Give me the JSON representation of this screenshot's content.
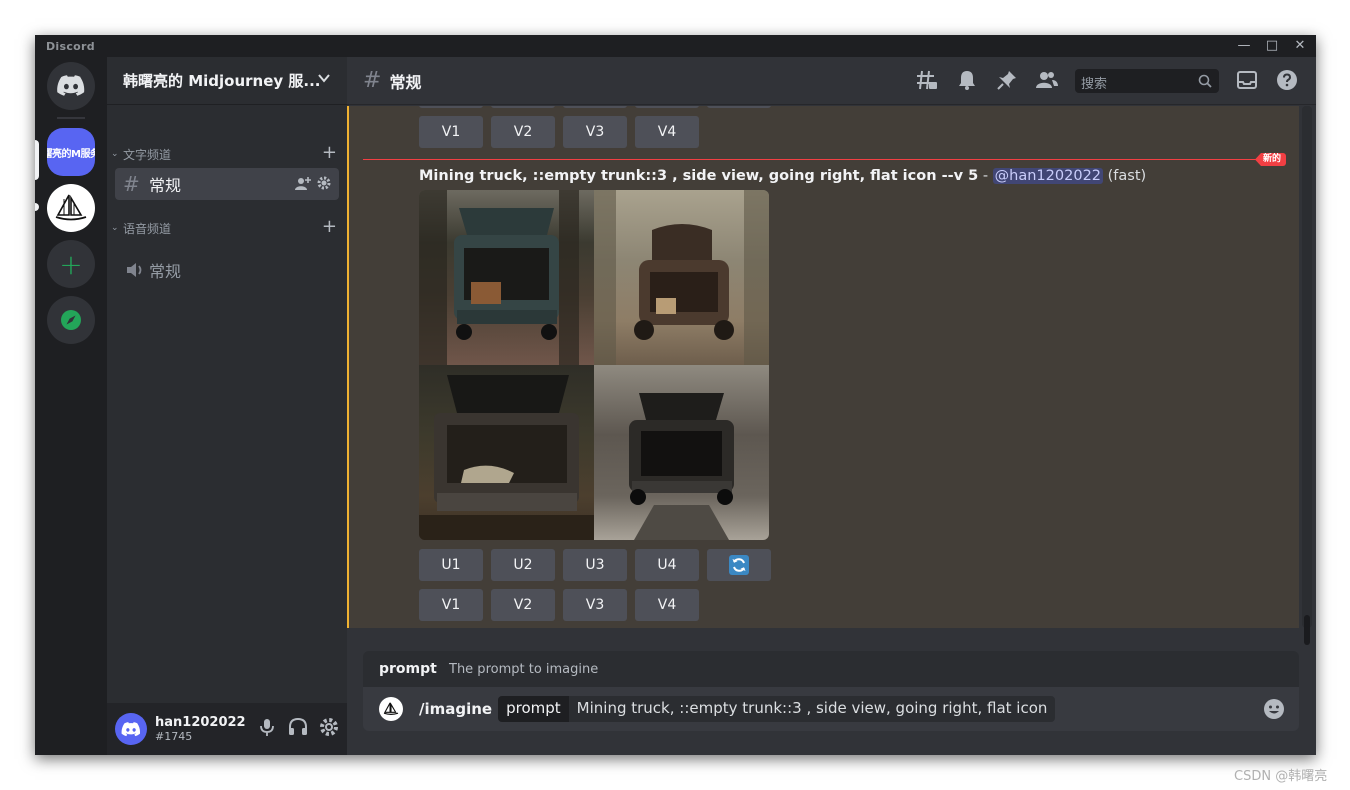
{
  "window": {
    "app_name": "Discord"
  },
  "servers": [
    {
      "name": "Discord home",
      "icon": "discord-icon"
    },
    {
      "name": "韩曙亮的M服务器",
      "label": "曙亮的M服务"
    },
    {
      "name": "Midjourney",
      "icon": "sailboat-icon"
    },
    {
      "name": "Add a server",
      "icon": "plus-icon"
    },
    {
      "name": "Explore",
      "icon": "compass-icon"
    }
  ],
  "guild": {
    "name": "韩曙亮的 Midjourney 服..."
  },
  "categories": {
    "text": "文字频道",
    "voice": "语音频道"
  },
  "channels": {
    "text_channel": "常规",
    "voice_channel": "常规"
  },
  "user": {
    "name": "han1202022",
    "tag": "#1745"
  },
  "topbar": {
    "channel": "常规",
    "search_placeholder": "搜索"
  },
  "chat": {
    "upper_variation_buttons": [
      "V1",
      "V2",
      "V3",
      "V4"
    ],
    "new_badge": "新的",
    "message": {
      "prompt": "Mining truck, ::empty trunk::3 , side view, going right, flat icon --v 5",
      "separator": " - ",
      "mention": "@han1202022",
      "mode": " (fast)"
    },
    "upscale_buttons": [
      "U1",
      "U2",
      "U3",
      "U4"
    ],
    "variation_buttons": [
      "V1",
      "V2",
      "V3",
      "V4"
    ]
  },
  "autocomplete": {
    "option": "prompt",
    "description": "The prompt to imagine"
  },
  "composer": {
    "command": "/imagine",
    "param_name": "prompt",
    "param_value": "Mining truck, ::empty trunk::3 , side view, going right, flat icon"
  },
  "watermark": "CSDN @韩曙亮",
  "colors": {
    "brand": "#5865f2",
    "highlight_border": "#f0b232",
    "new_red": "#f23f43",
    "online_green": "#23a559"
  }
}
